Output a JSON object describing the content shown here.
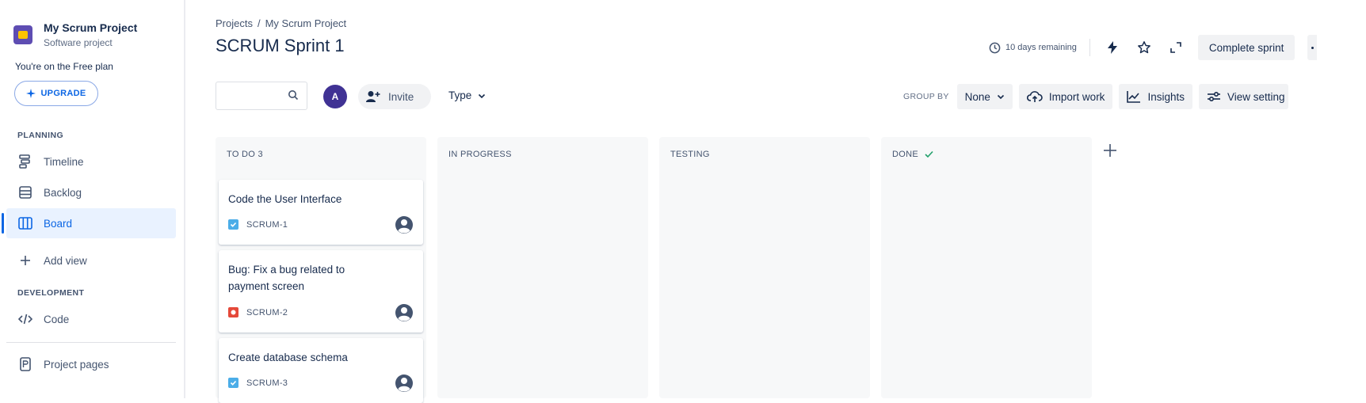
{
  "sidebar": {
    "project_name": "My Scrum Project",
    "project_type": "Software project",
    "plan_text": "You're on the Free plan",
    "upgrade_label": "UPGRADE",
    "planning_label": "PLANNING",
    "items": [
      {
        "label": "Timeline",
        "icon": "timeline-icon"
      },
      {
        "label": "Backlog",
        "icon": "backlog-icon"
      },
      {
        "label": "Board",
        "icon": "board-icon",
        "active": true
      },
      {
        "label": "Add view",
        "icon": "plus-icon"
      }
    ],
    "development_label": "DEVELOPMENT",
    "code_label": "Code",
    "project_pages_label": "Project pages"
  },
  "header": {
    "breadcrumb": [
      "Projects",
      "My Scrum Project"
    ],
    "breadcrumb_separator": "/",
    "title": "SCRUM Sprint 1",
    "remaining": "10 days remaining",
    "complete_label": "Complete sprint"
  },
  "toolbar": {
    "search_value": "",
    "search_placeholder": "",
    "avatar_initial": "A",
    "invite_label": "Invite",
    "type_label": "Type",
    "group_by_label": "GROUP BY",
    "group_by_value": "None",
    "import_label": "Import work",
    "insights_label": "Insights",
    "view_settings_label": "View setting"
  },
  "board": {
    "columns": [
      {
        "title": "TO DO 3"
      },
      {
        "title": "IN PROGRESS"
      },
      {
        "title": "TESTING"
      },
      {
        "title": "DONE"
      }
    ],
    "cards": [
      {
        "title": "Code the User Interface",
        "key": "SCRUM-1",
        "type": "task"
      },
      {
        "title": "Bug: Fix a bug related to payment screen",
        "key": "SCRUM-2",
        "type": "bug"
      },
      {
        "title": "Create database schema",
        "key": "SCRUM-3",
        "type": "task"
      }
    ]
  },
  "colors": {
    "accent": "#0c66e4",
    "avatar": "#403294",
    "task": "#4bade8",
    "bug": "#e5493a",
    "column_bg": "#f7f8f9"
  }
}
